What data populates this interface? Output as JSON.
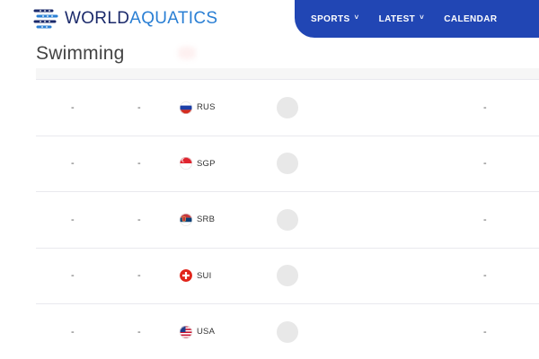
{
  "brand": {
    "word1": "WORLD",
    "word2": "AQUATICS",
    "logo_icon": "world-aquatics-logo-icon"
  },
  "nav": {
    "items": [
      {
        "label": "SPORTS",
        "has_dropdown": true
      },
      {
        "label": "LATEST",
        "has_dropdown": true
      },
      {
        "label": "CALENDAR",
        "has_dropdown": false
      }
    ],
    "chevron": "˅",
    "bg_color": "#2146b4"
  },
  "page": {
    "title": "Swimming"
  },
  "rows": [
    {
      "col1": "-",
      "col2": "-",
      "country": "RUS",
      "flag": "russia-flag-icon",
      "col_last": "-"
    },
    {
      "col1": "-",
      "col2": "-",
      "country": "SGP",
      "flag": "singapore-flag-icon",
      "col_last": "-"
    },
    {
      "col1": "-",
      "col2": "-",
      "country": "SRB",
      "flag": "serbia-flag-icon",
      "col_last": "-"
    },
    {
      "col1": "-",
      "col2": "-",
      "country": "SUI",
      "flag": "switzerland-flag-icon",
      "col_last": "-"
    },
    {
      "col1": "-",
      "col2": "-",
      "country": "USA",
      "flag": "usa-flag-icon",
      "col_last": "-"
    }
  ]
}
